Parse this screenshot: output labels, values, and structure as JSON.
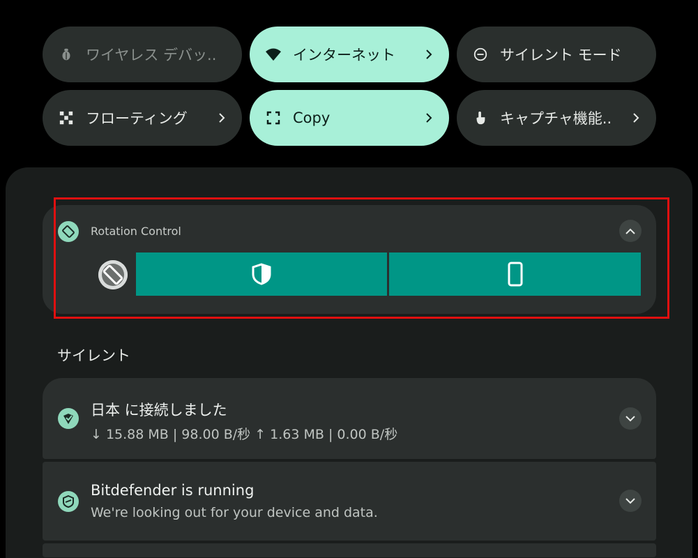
{
  "quick_settings": {
    "tiles": [
      {
        "label": "ワイヤレス デバッ..",
        "icon": "bug-icon",
        "active": false
      },
      {
        "label": "インターネット",
        "icon": "wifi-icon",
        "active": true
      },
      {
        "label": "サイレント モード",
        "icon": "do-not-disturb-icon",
        "active": false
      },
      {
        "label": "フローティング",
        "icon": "floating-icon",
        "active": false
      },
      {
        "label": "Copy",
        "icon": "fullscreen-icon",
        "active": true
      },
      {
        "label": "キャプチャ機能..",
        "icon": "touch-icon",
        "active": false
      }
    ]
  },
  "rotation_control": {
    "app_name": "Rotation Control",
    "buttons": [
      {
        "icon": "shield-icon"
      },
      {
        "icon": "portrait-phone-icon"
      }
    ]
  },
  "section": {
    "label": "サイレント"
  },
  "notifications": [
    {
      "title": "日本 に接続しました",
      "subtitle": "↓ 15.88 MB | 98.00 B/秒  ↑ 1.63 MB | 0.00 B/秒",
      "icon": "vpn-icon"
    },
    {
      "title": "Bitdefender is running",
      "subtitle": "We're looking out for your device and data.",
      "icon": "bitdefender-icon"
    }
  ],
  "colors": {
    "tile_active": "#a8f0d8",
    "tile_inactive": "#2a2f2d",
    "action_button": "#009686",
    "highlight_border": "#e01010"
  }
}
